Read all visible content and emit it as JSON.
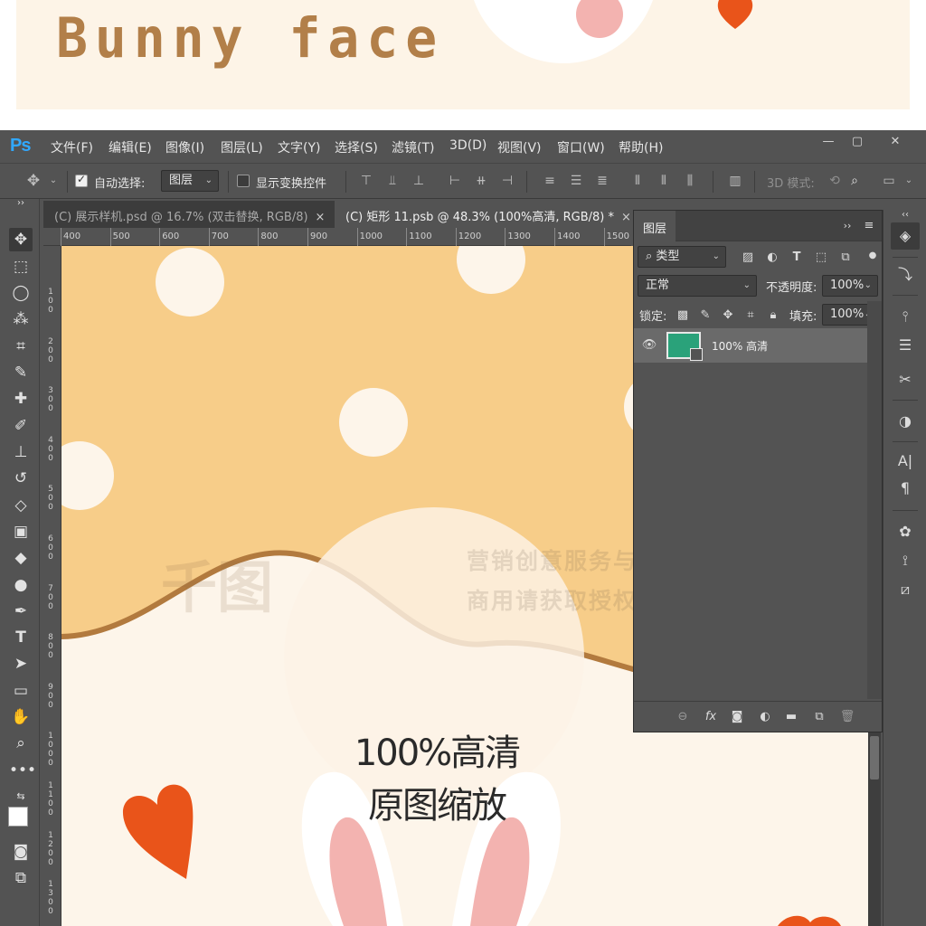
{
  "banner": {
    "title": "Bunny face"
  },
  "app": {
    "logo": "Ps",
    "menu": [
      "文件(F)",
      "编辑(E)",
      "图像(I)",
      "图层(L)",
      "文字(Y)",
      "选择(S)",
      "滤镜(T)",
      "3D(D)",
      "视图(V)",
      "窗口(W)",
      "帮助(H)"
    ],
    "window_controls": [
      "—",
      "▢",
      "✕"
    ]
  },
  "options_bar": {
    "auto_select_label": "自动选择:",
    "auto_select_checked": true,
    "auto_select_target": "图层",
    "show_transform_label": "显示变换控件",
    "show_transform_checked": false,
    "mode_3d_label": "3D 模式:"
  },
  "tabs": [
    {
      "label": "(C) 展示样机.psd @ 16.7% (双击替换, RGB/8)",
      "close": "×",
      "active": false
    },
    {
      "label": "(C) 矩形 11.psb @ 48.3% (100%高清, RGB/8) *",
      "close": "×",
      "active": true
    }
  ],
  "ruler": {
    "h_labels": [
      "400",
      "500",
      "600",
      "700",
      "800",
      "900",
      "1000",
      "1100",
      "1200",
      "1300",
      "1400",
      "1500"
    ],
    "v_labels": [
      "100",
      "200",
      "300",
      "400",
      "500",
      "600",
      "700",
      "800",
      "900",
      "1000",
      "1100",
      "1200",
      "1300"
    ]
  },
  "canvas": {
    "zoom_line1": "100%高清",
    "zoom_line2": "原图缩放",
    "watermark_logo": "千图",
    "watermark_line1": "营销创意服务与协作平台",
    "watermark_line2": "商用请获取授权",
    "colors": {
      "top": "#f7cd89",
      "bottom": "#fdf5ea",
      "curve": "#b27a3e",
      "heart": "#e9541a",
      "ear_inner": "#f3b3b0"
    }
  },
  "layers_panel": {
    "tab": "图层",
    "filter_label": "类型",
    "blend_mode": "正常",
    "opacity_label": "不透明度:",
    "opacity_value": "100%",
    "lock_label": "锁定:",
    "fill_label": "填充:",
    "fill_value": "100%",
    "layer_name": "100% 高清",
    "layer_color": "#2aa27a"
  }
}
